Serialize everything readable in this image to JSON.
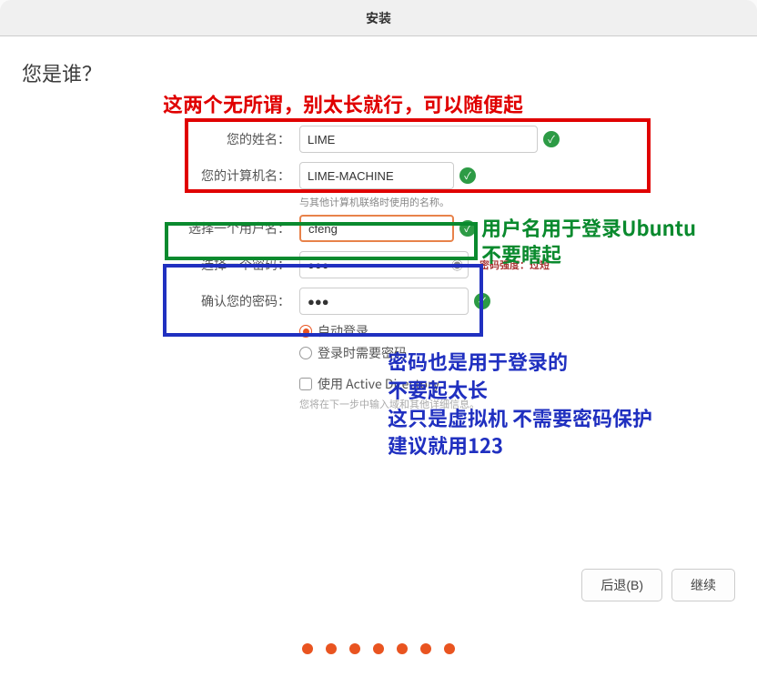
{
  "titlebar": {
    "title": "安装"
  },
  "heading": "您是谁？",
  "form": {
    "name_label": "您的姓名：",
    "name_value": "LIME",
    "computer_label": "您的计算机名：",
    "computer_value": "LIME-MACHINE",
    "computer_hint": "与其他计算机联络时使用的名称。",
    "username_label": "选择一个用户名：",
    "username_value": "cfeng",
    "password_label": "选择一个密码：",
    "password_value": "●●●",
    "password_strength": "密码强度：过短",
    "confirm_label": "确认您的密码：",
    "confirm_value": "●●●",
    "auto_login": "自动登录",
    "require_password": "登录时需要密码",
    "use_ad": "使用 Active Directory",
    "ad_hint": "您将在下一步中输入域和其他详细信息。"
  },
  "annotations": {
    "red_text": "这两个无所谓，别太长就行，可以随便起",
    "green_text": "用户名用于登录Ubuntu\n不要瞎起",
    "blue_text": "密码也是用于登录的\n不要起太长\n这只是虚拟机 不需要密码保护\n建议就用123"
  },
  "footer": {
    "back": "后退(B)",
    "continue": "继续"
  },
  "progress_dots": 7
}
